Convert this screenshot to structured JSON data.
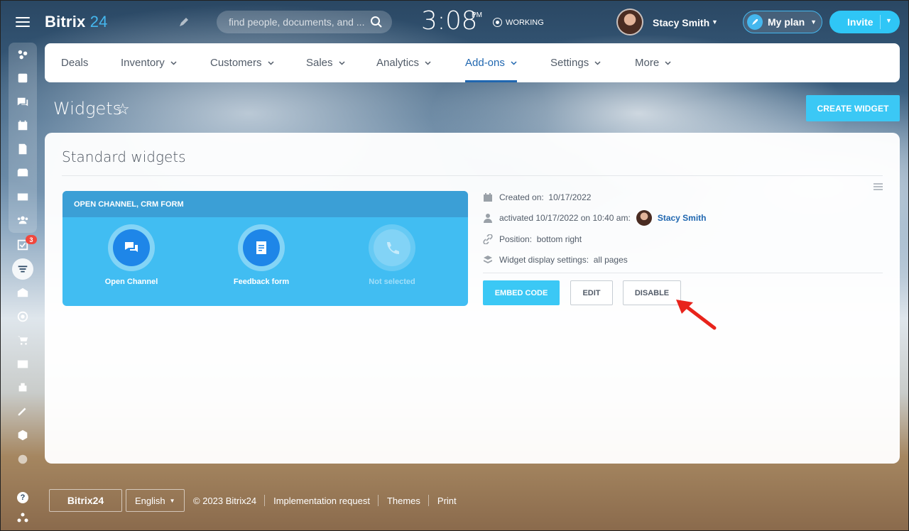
{
  "header": {
    "logo_text": "Bitrix",
    "logo_num": "24",
    "search_placeholder": "find people, documents, and ...",
    "clock": "3:08",
    "clock_suffix": "PM",
    "status": "WORKING",
    "user_name": "Stacy Smith",
    "plan_label": "My plan",
    "invite_label": "Invite"
  },
  "sidebar": {
    "tasks_badge": "3",
    "icons": [
      "menu-icon",
      "activity-stream-icon",
      "news-feed-icon",
      "chat-icon",
      "calendar-icon",
      "documents-icon",
      "drive-icon",
      "mail-icon",
      "workgroups-icon",
      "tasks-icon",
      "crm-icon",
      "company-icon",
      "marketing-icon",
      "shop-icon",
      "contact-center-icon",
      "automation-icon",
      "sign-icon",
      "inventory-icon",
      "more-icon",
      "help-icon",
      "network-icon"
    ]
  },
  "nav": {
    "items": [
      {
        "label": "Deals",
        "has_menu": false
      },
      {
        "label": "Inventory",
        "has_menu": true
      },
      {
        "label": "Customers",
        "has_menu": true
      },
      {
        "label": "Sales",
        "has_menu": true
      },
      {
        "label": "Analytics",
        "has_menu": true
      },
      {
        "label": "Add-ons",
        "has_menu": true,
        "active": true
      },
      {
        "label": "Settings",
        "has_menu": true
      },
      {
        "label": "More",
        "has_menu": true
      }
    ]
  },
  "page": {
    "title": "Widgets",
    "create_button": "CREATE WIDGET"
  },
  "card": {
    "title": "Standard widgets",
    "preview": {
      "header": "OPEN CHANNEL, CRM FORM",
      "items": [
        {
          "label": "Open Channel",
          "icon": "chat-bubbles-icon",
          "selected": true
        },
        {
          "label": "Feedback form",
          "icon": "form-icon",
          "selected": true
        },
        {
          "label": "Not selected",
          "icon": "phone-icon",
          "selected": false
        }
      ]
    },
    "info": {
      "created_label": "Created on:",
      "created_value": "10/17/2022",
      "activated_text": "activated 10/17/2022 on 10:40 am:",
      "activated_user": "Stacy Smith",
      "position_label": "Position:",
      "position_value": "bottom right",
      "display_label": "Widget display settings:",
      "display_value": "all pages"
    },
    "buttons": {
      "embed": "EMBED CODE",
      "edit": "EDIT",
      "disable": "DISABLE"
    }
  },
  "footer": {
    "logo": "Bitrix24",
    "language": "English",
    "copyright": "© 2023 Bitrix24",
    "links": [
      "Implementation request",
      "Themes",
      "Print"
    ]
  },
  "colors": {
    "accent": "#3bc8f5",
    "active_nav": "#2067b0",
    "widget_blue": "#41bdf2",
    "annotation_arrow": "#e8231b"
  }
}
